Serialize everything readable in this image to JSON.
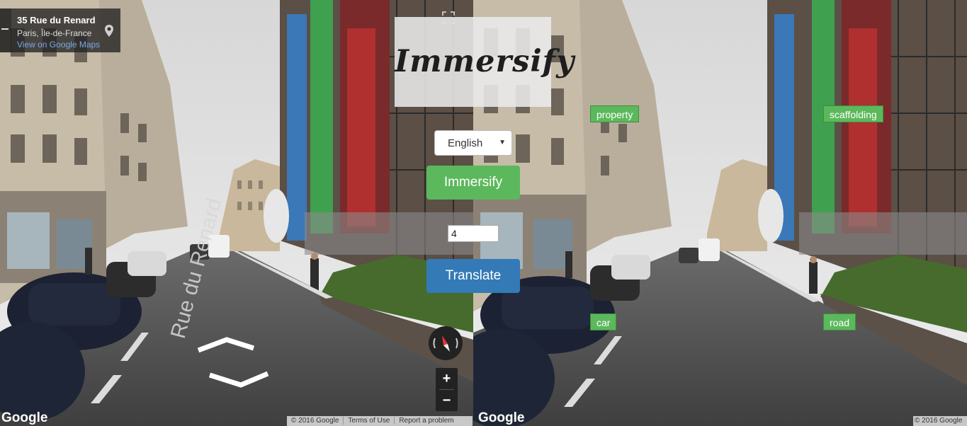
{
  "address_card": {
    "title": "35 Rue du Renard",
    "subtitle": "Paris, Île-de-France",
    "link": "View on Google Maps",
    "pin_icon": "map-pin-icon"
  },
  "app": {
    "logo": "Immersify",
    "language_select": {
      "selected": "English"
    },
    "immersify_button": "Immersify",
    "count_input": {
      "value": "4"
    },
    "translate_button": "Translate"
  },
  "map_controls": {
    "zoom_in": "+",
    "zoom_out": "−",
    "compass_icon": "compass-icon",
    "fullscreen_icon": "fullscreen-icon"
  },
  "attribution": {
    "logo": "Google",
    "copyright": "© 2016 Google",
    "terms": "Terms of Use",
    "report": "Report a problem"
  },
  "word_labels": [
    {
      "word": "property"
    },
    {
      "word": "scaffolding"
    },
    {
      "word": "car"
    },
    {
      "word": "road"
    }
  ],
  "colors": {
    "immersify_green": "#5cb85c",
    "translate_blue": "#337ab7"
  }
}
